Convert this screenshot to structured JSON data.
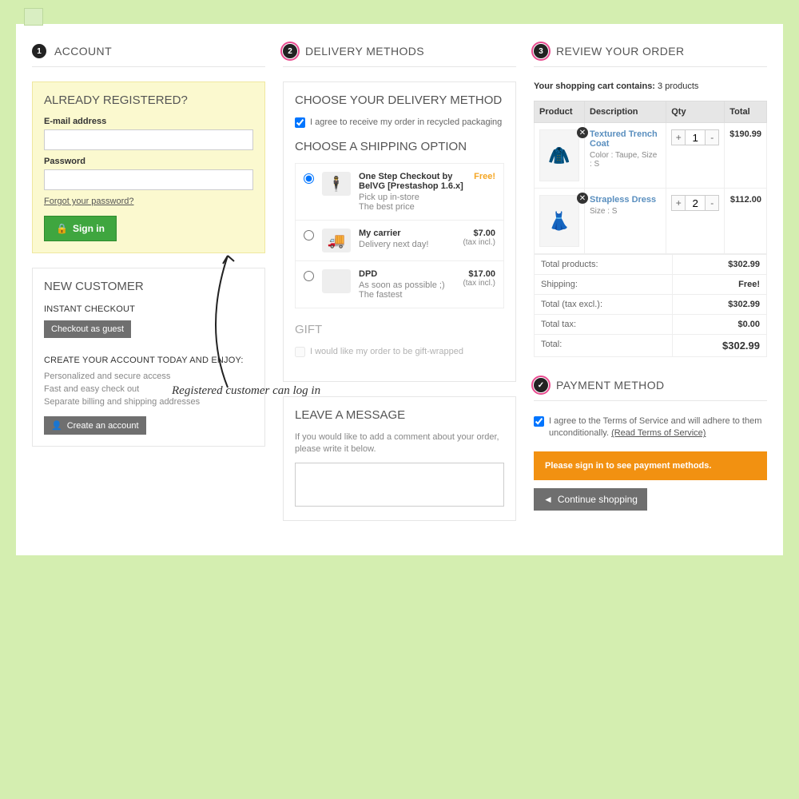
{
  "sections": {
    "account": {
      "num": "1",
      "title": "ACCOUNT"
    },
    "delivery": {
      "num": "2",
      "title": "DELIVERY METHODS"
    },
    "review": {
      "num": "3",
      "title": "REVIEW YOUR ORDER"
    },
    "payment": {
      "num": "✓",
      "title": "PAYMENT METHOD"
    }
  },
  "login": {
    "heading": "ALREADY REGISTERED?",
    "email_label": "E-mail address",
    "password_label": "Password",
    "forgot": "Forgot your password?",
    "signin": "Sign in"
  },
  "newcust": {
    "heading": "NEW CUSTOMER",
    "instant": "INSTANT CHECKOUT",
    "guest_btn": "Checkout as guest",
    "create_heading": "CREATE YOUR ACCOUNT TODAY AND ENJOY:",
    "b1": "Personalized and secure access",
    "b2": "Fast and easy check out",
    "b3": "Separate billing and shipping addresses",
    "create_btn": "Create an account"
  },
  "delivery": {
    "choose_method": "CHOOSE YOUR DELIVERY METHOD",
    "recycled": "I agree to receive my order in recycled packaging",
    "choose_ship": "CHOOSE A SHIPPING OPTION",
    "options": [
      {
        "name": "One Step Checkout by BelVG [Prestashop 1.6.x]",
        "d1": "Pick up in-store",
        "d2": "The best price",
        "price": "Free!",
        "tax": "",
        "checked": true,
        "icon": "🕴️"
      },
      {
        "name": "My carrier",
        "d1": "Delivery next day!",
        "d2": "",
        "price": "$7.00",
        "tax": "(tax incl.)",
        "checked": false,
        "icon": "🚚"
      },
      {
        "name": "DPD",
        "d1": "As soon as possible ;)",
        "d2": "The fastest",
        "price": "$17.00",
        "tax": "(tax incl.)",
        "checked": false,
        "icon": ""
      }
    ],
    "gift_heading": "GIFT",
    "gift_text": "I would like my order to be gift-wrapped",
    "message_heading": "LEAVE A MESSAGE",
    "message_hint": "If you would like to add a comment about your order, please write it below."
  },
  "review": {
    "intro_a": "Your shopping cart contains:",
    "intro_b": "3 products",
    "th": {
      "product": "Product",
      "desc": "Description",
      "qty": "Qty",
      "total": "Total"
    },
    "items": [
      {
        "name": "Textured Trench Coat",
        "attr": "Color : Taupe, Size : S",
        "qty": "1",
        "total": "$190.99",
        "emoji": "🧥"
      },
      {
        "name": "Strapless Dress",
        "attr": "Size : S",
        "qty": "2",
        "total": "$112.00",
        "emoji": "👗"
      }
    ],
    "totals": {
      "products_l": "Total products:",
      "products_v": "$302.99",
      "shipping_l": "Shipping:",
      "shipping_v": "Free!",
      "excl_l": "Total (tax excl.):",
      "excl_v": "$302.99",
      "tax_l": "Total tax:",
      "tax_v": "$0.00",
      "total_l": "Total:",
      "total_v": "$302.99"
    }
  },
  "payment": {
    "tos_a": "I agree to the Terms of Service and will adhere to them unconditionally.",
    "tos_link": "(Read Terms of Service)",
    "alert": "Please sign in to see payment methods.",
    "continue": "Continue shopping"
  },
  "annotation": "Registered customer can log in"
}
